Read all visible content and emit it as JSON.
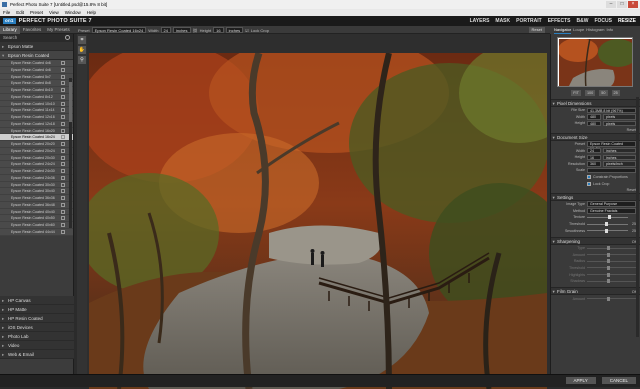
{
  "window": {
    "title": "Perfect Photo Suite 7 [Untitled.psd@15.8% 8 bit]"
  },
  "menu": [
    "File",
    "Edit",
    "Preset",
    "View",
    "Window",
    "Help"
  ],
  "brand": {
    "badge": "on1",
    "name": "PERFECT PHOTO SUITE 7"
  },
  "modules": [
    "LAYERS",
    "MASK",
    "PORTRAIT",
    "EFFECTS",
    "B&W",
    "FOCUS",
    "RESIZE"
  ],
  "left_tabs": [
    "Library",
    "Favorites",
    "My Presets"
  ],
  "options": {
    "preset_label": "Preset",
    "preset_value": "Epson Resin Coated 16x24",
    "width_label": "Width",
    "width_value": "24",
    "width_unit": "inches",
    "height_label": "Height",
    "height_value": "16",
    "height_unit": "inches",
    "lock_crop": "Lock Crop",
    "reset": "Reset"
  },
  "right_tabs": [
    "Navigator",
    "Loupe",
    "Histogram",
    "Info"
  ],
  "library": {
    "search": "Search",
    "top_category": "Epson Matte",
    "open_category": "Epson Resin Coated",
    "items": [
      "Epson Resin Coated 4x6",
      "Epson Resin Coated 4x6",
      "Epson Resin Coated 5x7",
      "Epson Resin Coated 8x8",
      "Epson Resin Coated 8x10",
      "Epson Resin Coated 8x12",
      "Epson Resin Coated 10x10",
      "Epson Resin Coated 11x14",
      "Epson Resin Coated 12x16",
      "Epson Resin Coated 12x18",
      "Epson Resin Coated 16x20",
      "Epson Resin Coated 16x24",
      "Epson Resin Coated 20x20",
      "Epson Resin Coated 20x24",
      "Epson Resin Coated 20x30",
      "Epson Resin Coated 24x24",
      "Epson Resin Coated 24x30",
      "Epson Resin Coated 24x36",
      "Epson Resin Coated 30x30",
      "Epson Resin Coated 30x40",
      "Epson Resin Coated 36x36",
      "Epson Resin Coated 36x48",
      "Epson Resin Coated 40x40",
      "Epson Resin Coated 40x50",
      "Epson Resin Coated 40x60",
      "Epson Resin Coated 44x44"
    ],
    "highlight_index": 11,
    "bottom_categories": [
      "HP Canvas",
      "HP Matte",
      "HP Resin Coated",
      "iOS Devices",
      "Photo Lab",
      "Video",
      "Web & Email"
    ]
  },
  "navigator": {
    "zoom": [
      "FIT",
      "100",
      "50",
      "25"
    ]
  },
  "pixel_dims": {
    "title": "Pixel Dimensions",
    "file_size_label": "File Size",
    "file_size": "41.3MB 8 bit (967%)",
    "width_label": "Width",
    "width_value": "480",
    "width_unit": "pixels",
    "height_label": "Height",
    "height_value": "480",
    "height_unit": "pixels",
    "reset": "Reset"
  },
  "doc_size": {
    "title": "Document Size",
    "preset_label": "Preset",
    "preset_value": "Epson Resin Coated 16x24",
    "width_label": "Width",
    "width_value": "24",
    "width_unit": "inches",
    "height_label": "Height",
    "height_value": "16",
    "height_unit": "inches",
    "resolution_label": "Resolution",
    "resolution_value": "360",
    "resolution_unit": "pixels/inch",
    "scale_label": "Scale",
    "constrain": "Constrain Proportions",
    "lock_crop": "Lock Crop",
    "reset": "Reset"
  },
  "settings": {
    "title": "Settings",
    "image_type_label": "Image Type",
    "image_type": "General Purpose",
    "method_label": "Method",
    "method": "Genuine Fractals",
    "texture_label": "Texture",
    "threshold_label": "Threshold",
    "threshold_value": "25",
    "smoothness_label": "Smoothness",
    "smoothness_value": "25"
  },
  "sharpening": {
    "title": "Sharpening",
    "toggle": "Off",
    "rows": [
      "Type",
      "Amount",
      "Radius",
      "Threshold",
      "Highlights",
      "Shadows"
    ]
  },
  "film_grain": {
    "title": "Film Grain",
    "toggle": "Off",
    "rows": [
      "Amount"
    ]
  },
  "footer": {
    "apply": "APPLY",
    "cancel": "CANCEL"
  }
}
